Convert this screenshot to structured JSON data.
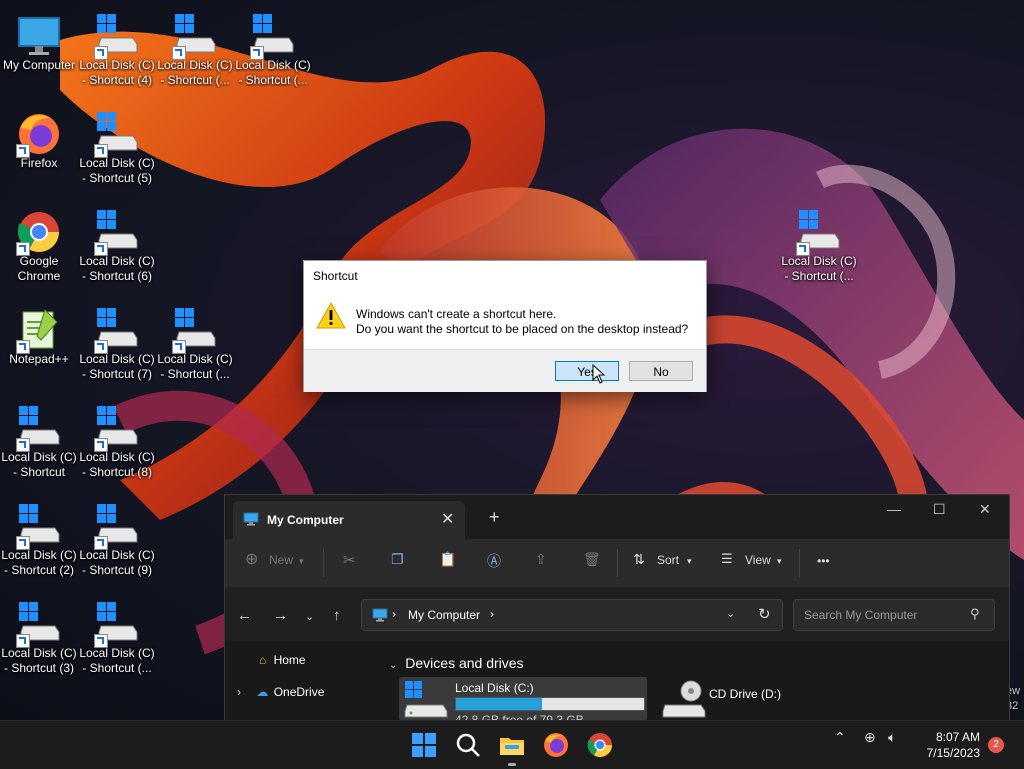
{
  "desktop": {
    "icons": [
      {
        "label": "My Computer",
        "type": "monitor"
      },
      {
        "label": "Local Disk (C) - Shortcut (4)",
        "type": "drive"
      },
      {
        "label": "Local Disk (C) - Shortcut (...",
        "type": "drive"
      },
      {
        "label": "Local Disk (C) - Shortcut (...",
        "type": "drive"
      },
      {
        "label": "Firefox",
        "type": "firefox"
      },
      {
        "label": "Local Disk (C) - Shortcut (5)",
        "type": "drive"
      },
      {
        "label": "Google Chrome",
        "type": "chrome"
      },
      {
        "label": "Local Disk (C) - Shortcut (6)",
        "type": "drive"
      },
      {
        "label": "Notepad++",
        "type": "notepad"
      },
      {
        "label": "Local Disk (C) - Shortcut (7)",
        "type": "drive"
      },
      {
        "label": "Local Disk (C) - Shortcut (...",
        "type": "drive"
      },
      {
        "label": "Local Disk (C) - Shortcut",
        "type": "drive"
      },
      {
        "label": "Local Disk (C) - Shortcut (8)",
        "type": "drive"
      },
      {
        "label": "Local Disk (C) - Shortcut (2)",
        "type": "drive"
      },
      {
        "label": "Local Disk (C) - Shortcut (9)",
        "type": "drive"
      },
      {
        "label": "Local Disk (C) - Shortcut (3)",
        "type": "drive"
      },
      {
        "label": "Local Disk (C) - Shortcut (...",
        "type": "drive"
      },
      {
        "label": "Local Disk (C) - Shortcut (...",
        "type": "drive"
      }
    ],
    "edge_text": [
      "ew",
      "32"
    ]
  },
  "dialog": {
    "title": "Shortcut",
    "line1": "Windows can't create a shortcut here.",
    "line2": "Do you want the shortcut to be placed on the desktop instead?",
    "yes_label": "Yes",
    "no_label": "No",
    "icon": "warning-icon"
  },
  "explorer": {
    "tab_title": "My Computer",
    "new_label": "New",
    "sort_label": "Sort",
    "view_label": "View",
    "more_label": "•••",
    "address": "My Computer",
    "search_placeholder": "Search My Computer",
    "nav_home": "Home",
    "nav_onedrive": "OneDrive",
    "section_title": "Devices and drives",
    "drive_c": {
      "name": "Local Disk (C:)",
      "free_text": "42.8 GB free of 79.3 GB",
      "used_fraction": 0.46
    },
    "drive_d": {
      "name": "CD Drive (D:)"
    }
  },
  "taskbar": {
    "time": "8:07 AM",
    "date": "7/15/2023",
    "notification_count": "2",
    "apps": [
      "start-icon",
      "search-icon",
      "file-explorer-icon",
      "firefox-icon",
      "chrome-icon"
    ]
  },
  "colors": {
    "accent": "#0078d7",
    "drive_fill": "#26a0da",
    "taskbar": "#1c1c1c"
  }
}
